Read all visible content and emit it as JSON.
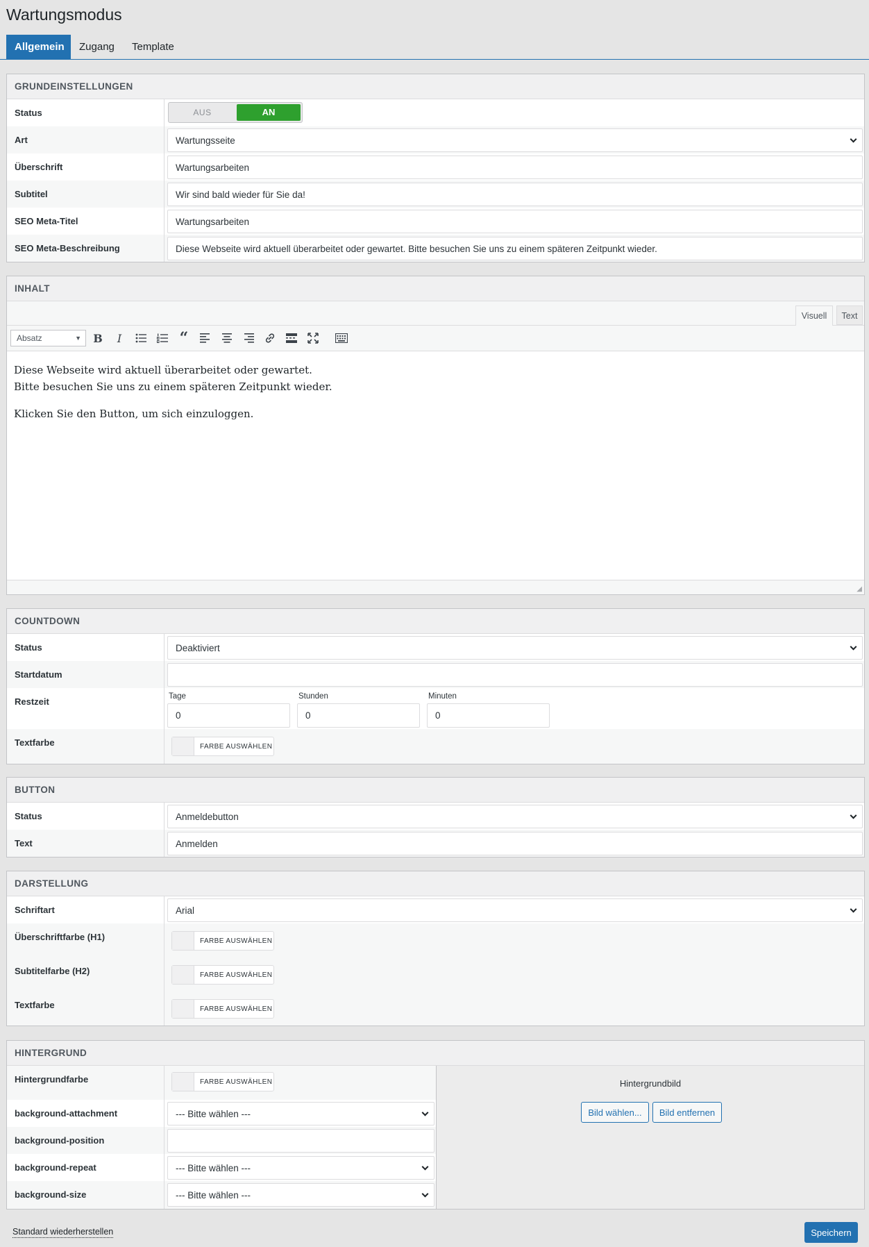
{
  "page": {
    "title": "Wartungsmodus"
  },
  "tabs": [
    {
      "label": "Allgemein"
    },
    {
      "label": "Zugang"
    },
    {
      "label": "Template"
    }
  ],
  "grund": {
    "heading": "Grundeinstellungen",
    "status": {
      "label": "Status",
      "off": "AUS",
      "on": "AN",
      "value": "on"
    },
    "art": {
      "label": "Art",
      "value": "Wartungsseite"
    },
    "ueberschrift": {
      "label": "Überschrift",
      "value": "Wartungsarbeiten"
    },
    "subtitel": {
      "label": "Subtitel",
      "value": "Wir sind bald wieder für Sie da!"
    },
    "seo_title": {
      "label": "SEO Meta-Titel",
      "value": "Wartungsarbeiten"
    },
    "seo_desc": {
      "label": "SEO Meta-Beschreibung",
      "value": "Diese Webseite wird aktuell überarbeitet oder gewartet. Bitte besuchen Sie uns zu einem späteren Zeitpunkt wieder."
    }
  },
  "inhalt": {
    "heading": "Inhalt",
    "tab_visual": "Visuell",
    "tab_text": "Text",
    "format": "Absatz",
    "toolbar_icons": [
      "bold-icon",
      "italic-icon",
      "bullet-list-icon",
      "numbered-list-icon",
      "blockquote-icon",
      "align-left-icon",
      "align-center-icon",
      "align-right-icon",
      "link-icon",
      "read-more-icon",
      "fullscreen-icon",
      "toolbar-toggle-icon"
    ],
    "line1": "Diese Webseite wird aktuell überarbeitet oder gewartet.",
    "line2": "Bitte besuchen Sie uns zu einem späteren Zeitpunkt wieder.",
    "line3": "Klicken Sie den Button, um sich einzuloggen."
  },
  "countdown": {
    "heading": "Countdown",
    "status": {
      "label": "Status",
      "value": "Deaktiviert"
    },
    "startdatum": {
      "label": "Startdatum",
      "value": ""
    },
    "restzeit": {
      "label": "Restzeit",
      "tage_label": "Tage",
      "tage": "0",
      "stunden_label": "Stunden",
      "stunden": "0",
      "minuten_label": "Minuten",
      "minuten": "0"
    },
    "textfarbe": {
      "label": "Textfarbe",
      "button": "FARBE AUSWÄHLEN"
    }
  },
  "button": {
    "heading": "Button",
    "status": {
      "label": "Status",
      "value": "Anmeldebutton"
    },
    "text": {
      "label": "Text",
      "value": "Anmelden"
    }
  },
  "darstellung": {
    "heading": "Darstellung",
    "schriftart": {
      "label": "Schriftart",
      "value": "Arial"
    },
    "h1": {
      "label": "Überschriftfarbe (H1)",
      "button": "FARBE AUSWÄHLEN"
    },
    "h2": {
      "label": "Subtitelfarbe (H2)",
      "button": "FARBE AUSWÄHLEN"
    },
    "text": {
      "label": "Textfarbe",
      "button": "FARBE AUSWÄHLEN"
    }
  },
  "hintergrund": {
    "heading": "Hintergrund",
    "farbe": {
      "label": "Hintergrundfarbe",
      "button": "FARBE AUSWÄHLEN"
    },
    "attachment": {
      "label": "background-attachment",
      "value": "--- Bitte wählen ---"
    },
    "position": {
      "label": "background-position",
      "value": ""
    },
    "repeat": {
      "label": "background-repeat",
      "value": "--- Bitte wählen ---"
    },
    "size": {
      "label": "background-size",
      "value": "--- Bitte wählen ---"
    },
    "bild": {
      "label": "Hintergrundbild",
      "choose": "Bild wählen...",
      "remove": "Bild entfernen"
    }
  },
  "footer": {
    "reset": "Standard wiederherstellen",
    "save": "Speichern"
  },
  "colors": {
    "accent": "#2271b1",
    "toggle_on": "#2ea02e"
  }
}
